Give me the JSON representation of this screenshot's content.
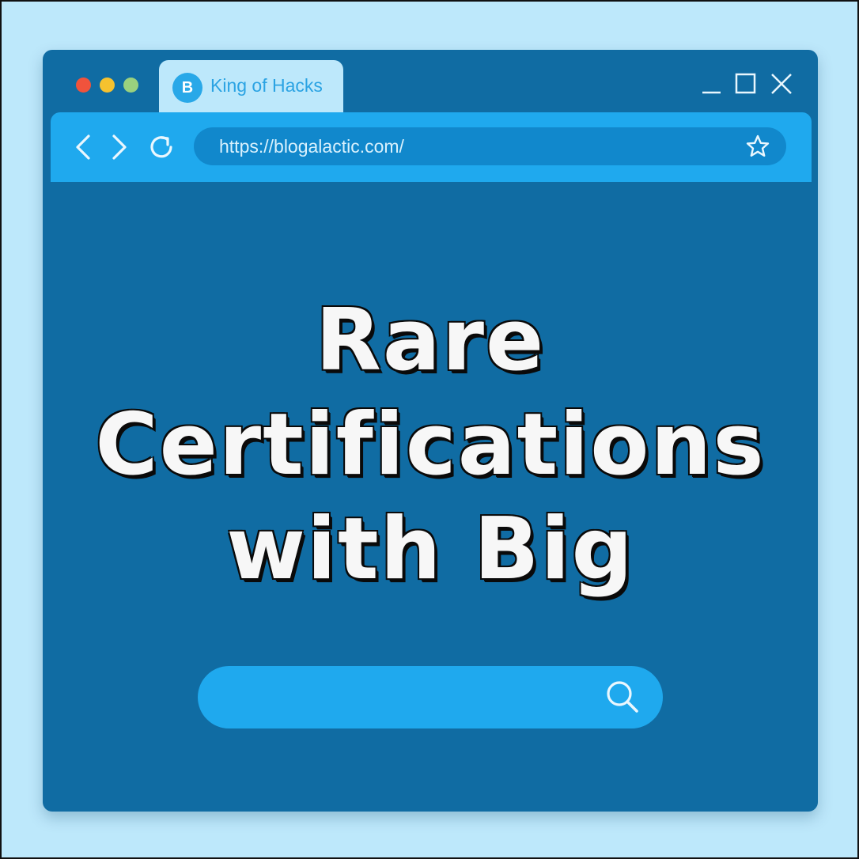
{
  "window": {
    "tab": {
      "icon_letter": "B",
      "title": "King of Hacks"
    },
    "traffic_lights": [
      "#f0533c",
      "#f6c22f",
      "#9ad17e"
    ],
    "address_bar": {
      "url": "https://blogalactic.com/"
    }
  },
  "content": {
    "headline_lines": [
      "Rare",
      "Certifications",
      "with Big"
    ],
    "search": {
      "value": ""
    }
  },
  "icons": {
    "nav": [
      "chevron-left-icon",
      "chevron-right-icon",
      "refresh-icon"
    ],
    "window_controls": [
      "minimize-icon",
      "maximize-icon",
      "close-icon"
    ],
    "address": "star-icon",
    "search": "search-icon"
  },
  "colors": {
    "background": "#bde8fb",
    "window": "#106ca3",
    "toolbar": "#1fa9ee",
    "url_bar": "#1188cc",
    "headline_text": "#f7f7f7"
  }
}
